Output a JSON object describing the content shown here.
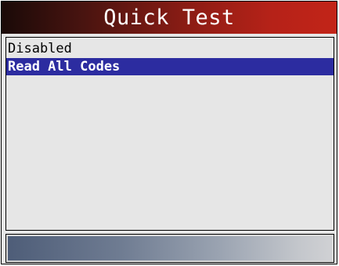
{
  "header": {
    "title": "Quick Test"
  },
  "menu": {
    "items": [
      {
        "label": "Disabled",
        "selected": false
      },
      {
        "label": "Read All Codes",
        "selected": true
      }
    ]
  },
  "colors": {
    "title_gradient_end": "#c22418",
    "selection_highlight": "#2c2ca0",
    "panel_background": "#e6e6e6",
    "status_bar_start": "#4e5d78"
  }
}
